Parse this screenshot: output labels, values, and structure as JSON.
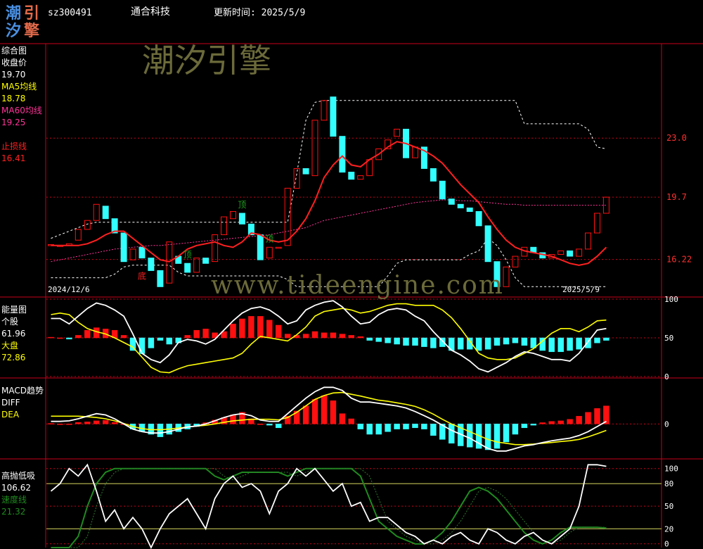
{
  "header": {
    "logo_chars": [
      "潮",
      "引",
      "汐",
      "擎"
    ],
    "stock_code": "sz300491",
    "stock_name": "通合科技",
    "update_label": "更新时间: 2025/5/9"
  },
  "watermark": {
    "brand": "潮汐引擎",
    "url": "www.tideengine.com"
  },
  "colors": {
    "up_red": "#ff1010",
    "down_cyan": "#33ffff",
    "ma5": "#ffff00",
    "ma60": "#ff3399",
    "stop_loss": "#ff2020",
    "grid_red": "#c8001a",
    "speed_green": "#1f8a1f",
    "watermark": "#6b6a3a"
  },
  "chart_data": [
    {
      "type": "candlestick",
      "panel": "综合图",
      "x_start": "2024/12/6",
      "x_end": "2025/5/9",
      "ylim": [
        14.2,
        28.2
      ],
      "y_ticks": [
        "23.0",
        "19.7",
        "16.22"
      ],
      "legend": [
        {
          "name": "收盘价",
          "value": "19.70",
          "color": "#ffffff"
        },
        {
          "name": "MA5均线",
          "value": "18.78",
          "color": "#ffff00"
        },
        {
          "name": "MA60均线",
          "value": "19.25",
          "color": "#ff3399"
        },
        {
          "name": "止损线",
          "value": "16.41",
          "color": "#ff2020"
        }
      ],
      "annotations": [
        {
          "text": "顶",
          "idx": 15,
          "color": "#1fa01f"
        },
        {
          "text": "顶",
          "idx": 21,
          "color": "#1fa01f"
        },
        {
          "text": "顶",
          "idx": 24,
          "color": "#1fa01f"
        },
        {
          "text": "底",
          "idx": 10,
          "color": "#ff2020"
        }
      ],
      "candles": [
        [
          17.05,
          17.05
        ],
        [
          17.0,
          17.0
        ],
        [
          17.0,
          17.1
        ],
        [
          17.3,
          17.9
        ],
        [
          17.9,
          18.4
        ],
        [
          18.4,
          19.3
        ],
        [
          19.2,
          18.5
        ],
        [
          18.5,
          17.7
        ],
        [
          17.7,
          16.1
        ],
        [
          16.2,
          16.8
        ],
        [
          16.9,
          16.3
        ],
        [
          16.3,
          15.6
        ],
        [
          15.6,
          14.7
        ],
        [
          14.9,
          17.2
        ],
        [
          16.4,
          16.0
        ],
        [
          16.0,
          15.5
        ],
        [
          15.5,
          16.3
        ],
        [
          16.3,
          16.0
        ],
        [
          16.1,
          17.6
        ],
        [
          17.6,
          18.6
        ],
        [
          18.5,
          18.9
        ],
        [
          18.8,
          18.2
        ],
        [
          18.2,
          17.6
        ],
        [
          17.6,
          16.2
        ],
        [
          16.3,
          16.9
        ],
        [
          16.9,
          16.9
        ],
        [
          17.0,
          20.2
        ],
        [
          20.2,
          21.3
        ],
        [
          21.3,
          21.0
        ],
        [
          20.9,
          24.0
        ],
        [
          24.0,
          25.1
        ],
        [
          25.3,
          23.1
        ],
        [
          23.1,
          21.1
        ],
        [
          21.1,
          20.7
        ],
        [
          20.7,
          20.9
        ],
        [
          20.9,
          21.8
        ],
        [
          21.8,
          22.4
        ],
        [
          22.4,
          22.9
        ],
        [
          23.1,
          23.5
        ],
        [
          23.5,
          21.9
        ],
        [
          21.9,
          22.5
        ],
        [
          22.5,
          21.3
        ],
        [
          21.3,
          20.6
        ],
        [
          20.6,
          19.6
        ],
        [
          19.6,
          19.3
        ],
        [
          19.3,
          19.1
        ],
        [
          19.1,
          18.9
        ],
        [
          18.9,
          18.1
        ],
        [
          18.1,
          16.1
        ],
        [
          16.1,
          14.7
        ],
        [
          14.7,
          15.8
        ],
        [
          15.8,
          16.4
        ],
        [
          16.4,
          16.9
        ],
        [
          16.9,
          16.6
        ],
        [
          16.6,
          16.3
        ],
        [
          16.3,
          16.5
        ],
        [
          16.5,
          16.7
        ],
        [
          16.7,
          16.4
        ],
        [
          16.4,
          16.8
        ],
        [
          16.8,
          17.7
        ],
        [
          17.7,
          18.8
        ],
        [
          18.8,
          19.7
        ]
      ],
      "ma5": [
        17.0,
        17.0,
        17.0,
        17.05,
        17.2,
        17.45,
        17.65,
        17.8,
        17.6,
        17.3,
        17.0,
        16.6,
        16.1,
        15.9,
        15.9,
        16.0,
        15.9,
        15.9,
        16.3,
        16.8,
        17.3,
        17.8,
        18.1,
        17.9,
        17.5,
        17.2,
        17.2,
        17.7,
        18.5,
        19.9,
        21.0,
        21.7,
        22.4,
        22.8,
        22.7,
        21.9,
        21.2,
        20.9,
        21.3,
        21.9,
        22.1,
        22.0,
        21.8,
        21.4,
        20.7,
        20.3,
        19.8,
        19.3,
        18.7,
        17.9,
        17.2,
        16.6,
        16.0,
        15.8,
        15.9,
        16.3,
        16.5,
        16.5,
        16.5,
        16.7,
        17.2,
        17.9
      ],
      "ma60": [
        16.1,
        16.2,
        16.3,
        16.4,
        16.5,
        16.6,
        16.7,
        16.8,
        16.85,
        16.9,
        16.95,
        17.0,
        17.0,
        17.05,
        17.1,
        17.15,
        17.2,
        17.25,
        17.3,
        17.35,
        17.4,
        17.45,
        17.5,
        17.55,
        17.6,
        17.7,
        17.8,
        17.9,
        18.0,
        18.2,
        18.4,
        18.5,
        18.6,
        18.7,
        18.8,
        18.9,
        19.0,
        19.1,
        19.2,
        19.3,
        19.4,
        19.45,
        19.5,
        19.55,
        19.55,
        19.5,
        19.5,
        19.45,
        19.4,
        19.35,
        19.3,
        19.3,
        19.25,
        19.25,
        19.25,
        19.25,
        19.25,
        19.25,
        19.25,
        19.25,
        19.25,
        19.25
      ],
      "stop_loss": [
        17.0,
        17.0,
        17.0,
        17.0,
        17.1,
        17.3,
        17.6,
        17.8,
        17.8,
        17.4,
        17.0,
        16.6,
        16.2,
        16.1,
        16.4,
        16.8,
        17.0,
        17.1,
        17.2,
        17.0,
        16.9,
        17.2,
        17.7,
        17.6,
        17.3,
        17.2,
        17.3,
        17.8,
        18.5,
        19.5,
        20.8,
        21.5,
        22.0,
        21.5,
        21.4,
        21.8,
        22.1,
        22.5,
        22.8,
        22.7,
        22.5,
        22.3,
        22.0,
        21.6,
        21.0,
        20.4,
        19.9,
        19.4,
        18.6,
        17.9,
        17.3,
        16.9,
        16.7,
        16.6,
        16.5,
        16.4,
        16.2,
        16.0,
        15.9,
        16.0,
        16.4,
        16.9
      ],
      "band_upper": [
        17.4,
        17.6,
        17.8,
        18.0,
        18.2,
        18.3,
        18.3,
        18.3,
        18.3,
        18.3,
        18.3,
        18.3,
        18.3,
        18.3,
        18.3,
        18.3,
        18.3,
        18.3,
        18.3,
        18.3,
        18.3,
        18.3,
        18.3,
        18.3,
        18.3,
        18.3,
        18.3,
        21.0,
        24.0,
        25.0,
        25.1,
        25.1,
        25.1,
        25.1,
        25.1,
        25.1,
        25.1,
        25.1,
        25.1,
        25.1,
        25.1,
        25.1,
        25.1,
        25.1,
        25.1,
        25.1,
        25.1,
        25.1,
        25.1,
        25.1,
        25.1,
        25.1,
        23.8,
        23.8,
        23.8,
        23.8,
        23.8,
        23.8,
        23.8,
        23.5,
        22.5,
        22.4
      ],
      "band_lower": [
        15.2,
        15.2,
        15.2,
        15.2,
        15.2,
        15.2,
        15.2,
        15.4,
        15.8,
        15.9,
        15.9,
        15.9,
        15.9,
        15.9,
        15.5,
        15.3,
        15.3,
        15.3,
        15.3,
        15.3,
        15.3,
        15.3,
        15.3,
        15.3,
        15.3,
        15.3,
        15.1,
        14.7,
        14.7,
        14.7,
        14.7,
        14.7,
        14.7,
        14.7,
        14.7,
        14.7,
        14.7,
        15.3,
        16.0,
        16.2,
        16.2,
        16.2,
        16.2,
        16.2,
        16.2,
        16.2,
        16.5,
        16.7,
        17.4,
        17.0,
        16.2,
        15.2,
        14.7,
        14.7,
        14.7,
        14.7,
        14.7,
        14.7,
        14.7,
        14.7,
        14.7,
        14.7
      ]
    },
    {
      "type": "bar+line",
      "panel": "能量图",
      "ylim": [
        0,
        100
      ],
      "y_ticks": [
        "100",
        "50",
        "0"
      ],
      "legend": [
        {
          "name": "个股",
          "value": "61.96",
          "color": "#ffffff"
        },
        {
          "name": "大盘",
          "value": "72.86",
          "color": "#ffff00"
        }
      ],
      "bars": [
        1,
        0,
        -2,
        4,
        12,
        16,
        14,
        12,
        4,
        -20,
        -25,
        -16,
        -4,
        -10,
        -8,
        4,
        12,
        14,
        8,
        10,
        22,
        30,
        34,
        34,
        28,
        20,
        6,
        4,
        6,
        10,
        8,
        8,
        6,
        4,
        2,
        -4,
        -6,
        -8,
        -10,
        -12,
        -12,
        -14,
        -16,
        -14,
        -20,
        -18,
        -18,
        -20,
        -18,
        -12,
        -10,
        -8,
        -12,
        -16,
        -20,
        -22,
        -22,
        -20,
        -18,
        -16,
        -8,
        -4
      ],
      "stock": [
        75,
        75,
        68,
        78,
        88,
        95,
        92,
        86,
        78,
        55,
        30,
        22,
        18,
        28,
        44,
        48,
        46,
        42,
        48,
        60,
        72,
        82,
        88,
        90,
        86,
        78,
        68,
        72,
        86,
        92,
        96,
        98,
        90,
        78,
        68,
        70,
        80,
        86,
        88,
        86,
        78,
        72,
        58,
        46,
        34,
        28,
        20,
        10,
        6,
        12,
        18,
        26,
        32,
        30,
        26,
        22,
        22,
        20,
        30,
        45,
        60,
        62
      ],
      "market": [
        80,
        82,
        80,
        70,
        62,
        58,
        55,
        50,
        44,
        38,
        25,
        12,
        6,
        5,
        10,
        14,
        16,
        18,
        20,
        22,
        24,
        30,
        42,
        52,
        50,
        48,
        46,
        54,
        64,
        78,
        84,
        86,
        88,
        86,
        82,
        84,
        88,
        92,
        94,
        94,
        92,
        92,
        92,
        86,
        76,
        62,
        46,
        30,
        24,
        22,
        22,
        24,
        30,
        36,
        46,
        56,
        62,
        62,
        58,
        64,
        72,
        73
      ]
    },
    {
      "type": "bar+line",
      "panel": "MACD趋势",
      "ylim": [
        -1.3,
        1.7
      ],
      "y_ticks": [
        "0"
      ],
      "legend": [
        {
          "name": "DIFF",
          "value": "",
          "color": "#ffffff"
        },
        {
          "name": "DEA",
          "value": "",
          "color": "#ffff00"
        }
      ],
      "bars": [
        0.02,
        0,
        0,
        0.06,
        0.08,
        0.12,
        0.14,
        0.06,
        0,
        -0.2,
        -0.3,
        -0.4,
        -0.5,
        -0.4,
        -0.3,
        -0.2,
        -0.1,
        0.05,
        0.15,
        0.25,
        0.35,
        0.45,
        0.2,
        0,
        -0.05,
        -0.15,
        0.3,
        0.5,
        0.7,
        0.95,
        1.1,
        0.9,
        0.4,
        0.2,
        -0.2,
        -0.4,
        -0.4,
        -0.3,
        -0.2,
        -0.2,
        -0.15,
        -0.2,
        -0.45,
        -0.6,
        -0.75,
        -0.85,
        -0.9,
        -0.95,
        -1.0,
        -0.95,
        -0.7,
        -0.4,
        -0.15,
        -0.05,
        0.05,
        0.1,
        0.12,
        0.18,
        0.3,
        0.45,
        0.6,
        0.7
      ],
      "diff": [
        0.1,
        0.1,
        0.12,
        0.2,
        0.3,
        0.4,
        0.35,
        0.2,
        0,
        -0.2,
        -0.3,
        -0.35,
        -0.35,
        -0.3,
        -0.2,
        -0.12,
        -0.08,
        0,
        0.12,
        0.25,
        0.35,
        0.4,
        0.32,
        0.15,
        0.1,
        0.1,
        0.4,
        0.7,
        1.0,
        1.25,
        1.42,
        1.42,
        1.3,
        1.0,
        0.85,
        0.85,
        0.8,
        0.75,
        0.7,
        0.62,
        0.48,
        0.32,
        0.15,
        -0.05,
        -0.25,
        -0.4,
        -0.55,
        -0.75,
        -0.95,
        -1.05,
        -1.05,
        -0.95,
        -0.85,
        -0.8,
        -0.72,
        -0.65,
        -0.6,
        -0.55,
        -0.45,
        -0.3,
        -0.1,
        0.1
      ],
      "dea": [
        0.3,
        0.3,
        0.3,
        0.3,
        0.28,
        0.25,
        0.2,
        0.12,
        0.02,
        -0.1,
        -0.18,
        -0.22,
        -0.22,
        -0.2,
        -0.16,
        -0.12,
        -0.08,
        -0.05,
        0,
        0.06,
        0.12,
        0.15,
        0.18,
        0.18,
        0.18,
        0.16,
        0.25,
        0.45,
        0.7,
        0.95,
        1.1,
        1.2,
        1.22,
        1.15,
        1.08,
        1.0,
        0.92,
        0.88,
        0.82,
        0.76,
        0.68,
        0.55,
        0.38,
        0.18,
        0,
        -0.15,
        -0.3,
        -0.45,
        -0.6,
        -0.7,
        -0.75,
        -0.8,
        -0.8,
        -0.78,
        -0.75,
        -0.72,
        -0.68,
        -0.65,
        -0.6,
        -0.5,
        -0.38,
        -0.25
      ]
    },
    {
      "type": "line",
      "panel": "高抛低吸",
      "ylim": [
        -5,
        110
      ],
      "y_ticks": [
        "100",
        "80",
        "50",
        "20",
        "0"
      ],
      "guide_lines": [
        80,
        20
      ],
      "legend": [
        {
          "name": "高抛低吸",
          "value": "106.62",
          "color": "#ffffff"
        },
        {
          "name": "速度线",
          "value": "21.32",
          "color": "#1f8a1f"
        }
      ],
      "white": [
        70,
        80,
        100,
        90,
        105,
        70,
        30,
        45,
        20,
        35,
        20,
        -5,
        20,
        40,
        50,
        60,
        40,
        20,
        60,
        80,
        90,
        75,
        80,
        70,
        40,
        70,
        80,
        100,
        90,
        100,
        85,
        70,
        80,
        50,
        55,
        30,
        35,
        35,
        25,
        15,
        10,
        0,
        5,
        0,
        10,
        15,
        5,
        0,
        20,
        15,
        5,
        0,
        10,
        15,
        5,
        0,
        10,
        20,
        50,
        105,
        105,
        103
      ],
      "green": [
        -5,
        -5,
        -5,
        10,
        50,
        80,
        95,
        100,
        100,
        100,
        100,
        100,
        100,
        100,
        100,
        100,
        100,
        100,
        90,
        85,
        90,
        95,
        95,
        95,
        95,
        95,
        90,
        95,
        100,
        100,
        100,
        100,
        100,
        100,
        90,
        60,
        30,
        20,
        10,
        5,
        0,
        0,
        5,
        15,
        30,
        50,
        70,
        75,
        70,
        60,
        45,
        30,
        15,
        5,
        0,
        5,
        15,
        22,
        22,
        22,
        22,
        21
      ]
    }
  ]
}
